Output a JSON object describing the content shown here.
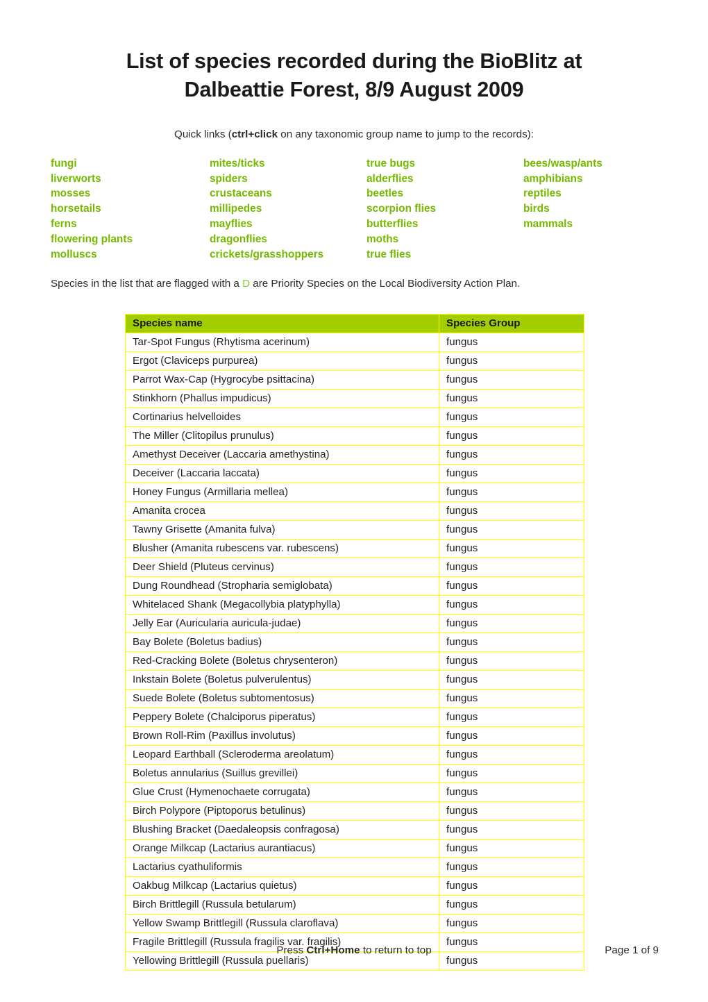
{
  "document": {
    "title": "List of species recorded during the BioBlitz at Dalbeattie Forest, 8/9 August 2009",
    "quick_links_intro_prefix": "Quick links (",
    "quick_links_intro_bold": "ctrl+click",
    "quick_links_intro_suffix": " on any taxonomic group name to jump to the records):",
    "priority_note_prefix": "Species in the list that are flagged with a ",
    "priority_note_flag": "D",
    "priority_note_suffix": " are Priority Species on the Local Biodiversity Action Plan."
  },
  "colors": {
    "link_green": "#76b900",
    "header_green": "#a2cd00",
    "border_yellow": "#ffff00",
    "flag_green": "#8dc63f",
    "text": "#231f20"
  },
  "quick_links": {
    "columns": [
      [
        "fungi",
        "liverworts",
        "mosses",
        "horsetails",
        "ferns",
        "flowering plants",
        "molluscs"
      ],
      [
        "mites/ticks",
        "spiders",
        "crustaceans",
        "millipedes",
        "mayflies",
        "dragonflies",
        "crickets/grasshoppers"
      ],
      [
        "true bugs",
        "alderflies",
        "beetles",
        "scorpion flies",
        "butterflies",
        "moths",
        "true flies"
      ],
      [
        "bees/wasp/ants",
        "amphibians",
        "reptiles",
        "birds",
        "mammals"
      ]
    ]
  },
  "table": {
    "headers": [
      "Species name",
      "Species Group"
    ],
    "rows": [
      [
        "Tar-Spot Fungus (Rhytisma acerinum)",
        "fungus"
      ],
      [
        "Ergot (Claviceps purpurea)",
        "fungus"
      ],
      [
        "Parrot Wax-Cap (Hygrocybe psittacina)",
        "fungus"
      ],
      [
        "Stinkhorn (Phallus impudicus)",
        "fungus"
      ],
      [
        "Cortinarius helvelloides",
        "fungus"
      ],
      [
        "The Miller (Clitopilus prunulus)",
        "fungus"
      ],
      [
        "Amethyst Deceiver (Laccaria amethystina)",
        "fungus"
      ],
      [
        "Deceiver (Laccaria laccata)",
        "fungus"
      ],
      [
        "Honey Fungus (Armillaria mellea)",
        "fungus"
      ],
      [
        "Amanita crocea",
        "fungus"
      ],
      [
        "Tawny Grisette (Amanita fulva)",
        "fungus"
      ],
      [
        "Blusher (Amanita rubescens var. rubescens)",
        "fungus"
      ],
      [
        "Deer Shield (Pluteus cervinus)",
        "fungus"
      ],
      [
        "Dung Roundhead (Stropharia semiglobata)",
        "fungus"
      ],
      [
        "Whitelaced Shank (Megacollybia platyphylla)",
        "fungus"
      ],
      [
        "Jelly Ear (Auricularia auricula-judae)",
        "fungus"
      ],
      [
        "Bay Bolete (Boletus badius)",
        "fungus"
      ],
      [
        "Red-Cracking Bolete (Boletus chrysenteron)",
        "fungus"
      ],
      [
        "Inkstain Bolete (Boletus pulverulentus)",
        "fungus"
      ],
      [
        "Suede Bolete (Boletus subtomentosus)",
        "fungus"
      ],
      [
        "Peppery Bolete (Chalciporus piperatus)",
        "fungus"
      ],
      [
        "Brown Roll-Rim (Paxillus involutus)",
        "fungus"
      ],
      [
        "Leopard Earthball (Scleroderma areolatum)",
        "fungus"
      ],
      [
        "Boletus annularius (Suillus grevillei)",
        "fungus"
      ],
      [
        "Glue Crust (Hymenochaete corrugata)",
        "fungus"
      ],
      [
        "Birch Polypore (Piptoporus betulinus)",
        "fungus"
      ],
      [
        "Blushing Bracket (Daedaleopsis confragosa)",
        "fungus"
      ],
      [
        "Orange Milkcap (Lactarius aurantiacus)",
        "fungus"
      ],
      [
        "Lactarius cyathuliformis",
        "fungus"
      ],
      [
        "Oakbug Milkcap (Lactarius quietus)",
        "fungus"
      ],
      [
        "Birch Brittlegill (Russula betularum)",
        "fungus"
      ],
      [
        "Yellow Swamp Brittlegill (Russula claroflava)",
        "fungus"
      ],
      [
        "Fragile Brittlegill (Russula fragilis var. fragilis)",
        "fungus"
      ],
      [
        "Yellowing Brittlegill (Russula puellaris)",
        "fungus"
      ]
    ]
  },
  "footer": {
    "hint_prefix": "Press ",
    "hint_bold": "Ctrl+Home",
    "hint_suffix": " to return to top",
    "page_label": "Page 1 of 9"
  }
}
